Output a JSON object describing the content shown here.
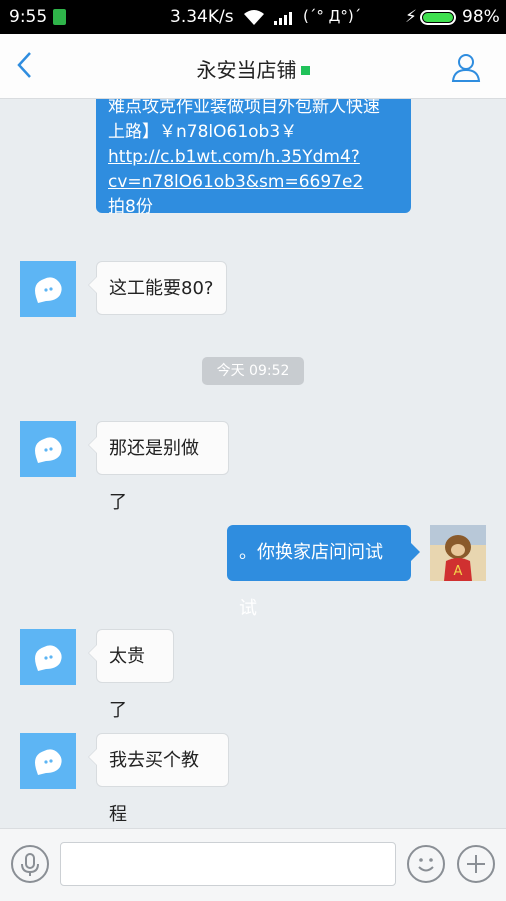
{
  "status": {
    "time": "9:55",
    "speed": "3.34K/s",
    "emoticon": "(´° Д°)´",
    "battery": "98%",
    "battery_level": 0.98
  },
  "nav": {
    "title": "永安当店铺",
    "online_color": "#20c25a"
  },
  "messages": {
    "forwarded": {
      "line1": "难点攻克作业装做项目外包新人快速",
      "line2": "上路】￥n78lO61ob3￥",
      "link1": "http://c.b1wt.com/h.35Ydm4?",
      "link2": "cv=n78lO61ob3&sm=6697e2",
      "line3": "拍8份"
    },
    "m1": "这工能要80?",
    "timestamp": "今天 09:52",
    "m2": "那还是别做了",
    "m3": "。你换家店问问试试",
    "m4": "太贵了",
    "m5": "我去买个教程"
  },
  "input": {
    "placeholder": ""
  },
  "colors": {
    "accent": "#2f8ddf",
    "bot_avatar": "#5db5f4"
  }
}
